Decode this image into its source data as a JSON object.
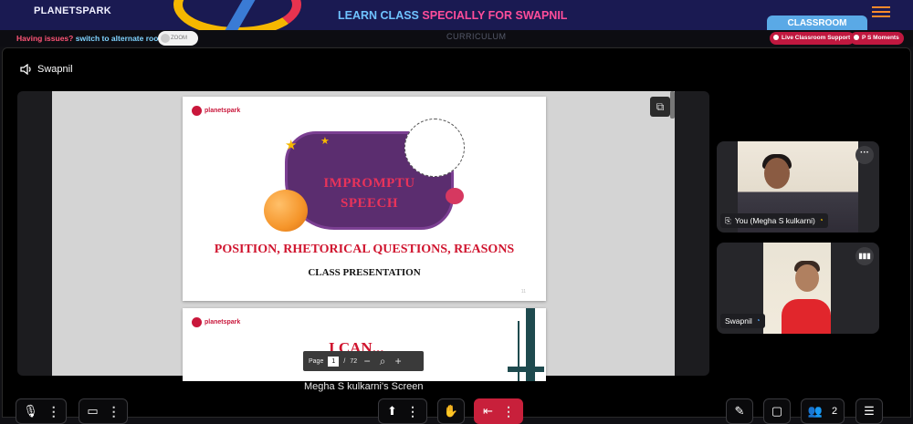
{
  "header": {
    "logo_text": "PLANETSPARK",
    "headline_part1": "LEARN CLASS",
    "headline_part2": "SPECIALLY FOR SWAPNIL",
    "classroom_tab": "CLASSROOM",
    "accent_orange": "#ff8a2b"
  },
  "statusbar": {
    "issues_question": "Having issues?",
    "issues_action": "switch to alternate room",
    "toggle_label": "ZOOM",
    "curriculum_label": "CURRICULUM",
    "live_support": "Live Classroom Support",
    "ps_moments": "P S Moments"
  },
  "speaker": {
    "name": "Swapnil",
    "icon": "speaker-icon"
  },
  "slides": {
    "slide1": {
      "logo": "planetspark",
      "title_line1": "IMPROMPTU",
      "title_line2": "SPEECH",
      "heading": "POSITION, RHETORICAL QUESTIONS, REASONS",
      "subheading": "CLASS PRESENTATION",
      "page_mark": "11"
    },
    "slide2": {
      "logo": "planetspark",
      "heading": "I CAN..."
    }
  },
  "pdf_toolbar": {
    "page_label": "Page",
    "current_page": "1",
    "separator": "/",
    "total_pages": "72",
    "zoom_out": "−",
    "zoom_search": "⌕",
    "zoom_in": "+"
  },
  "screen_label": "Megha S kulkarni's Screen",
  "participants": [
    {
      "name": "You (Megha S kulkarni)",
      "network": "wifi-icon"
    },
    {
      "name": "Swapnil",
      "network": "wifi-icon"
    }
  ],
  "controls": {
    "participants_count": "2"
  }
}
